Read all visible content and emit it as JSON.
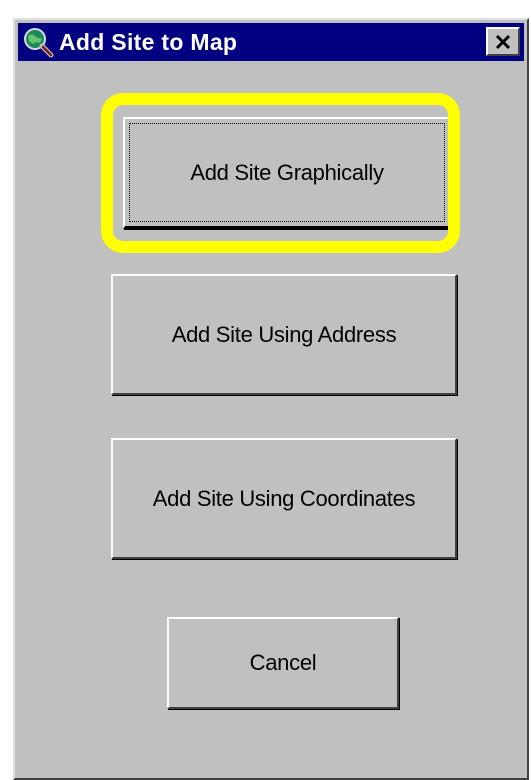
{
  "window": {
    "title": "Add Site to Map",
    "icon": "globe-magnifier-icon",
    "close_icon": "close-icon"
  },
  "buttons": {
    "graphically": "Add Site Graphically",
    "address": "Add Site Using Address",
    "coordinates": "Add Site Using Coordinates",
    "cancel": "Cancel"
  },
  "highlight": {
    "target": "add-site-graphically-button",
    "color": "#ffff00"
  },
  "colors": {
    "titlebar": "#000080",
    "face": "#c0c0c0"
  }
}
